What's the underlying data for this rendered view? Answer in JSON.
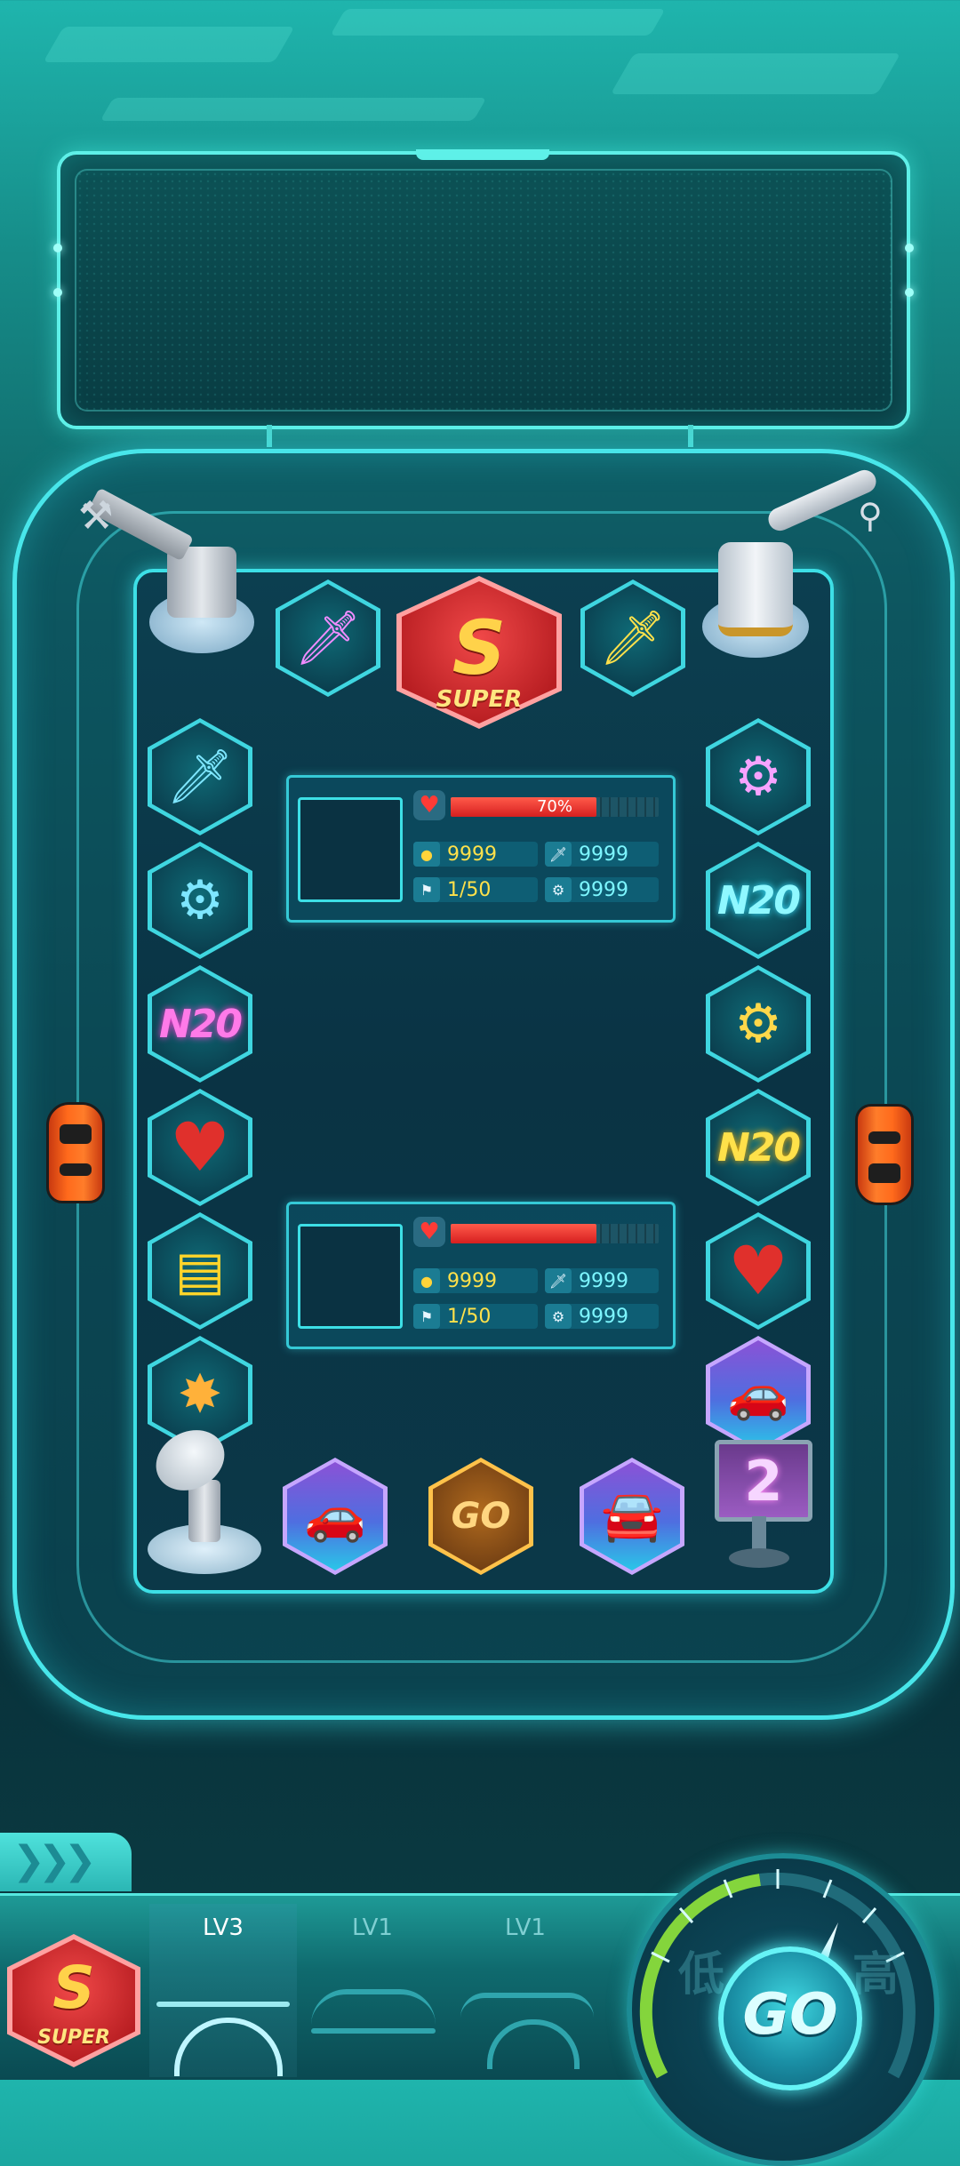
{
  "top": {
    "super_badge": {
      "label": "SUPER"
    },
    "item_tiles": [
      {
        "name": "sword-pink-icon",
        "glyph": "🗡",
        "color": "#f08cff"
      },
      {
        "name": "sword-yellow-icon",
        "glyph": "🗡",
        "color": "#ffe14a"
      }
    ]
  },
  "left_column": [
    {
      "name": "sword-blue-icon",
      "glyph": "🗡",
      "color": "#7ee6ff",
      "type": "glyph"
    },
    {
      "name": "wheel-blue-icon",
      "glyph": "⚙",
      "color": "#7ee6ff",
      "type": "glyph"
    },
    {
      "name": "n2o-pink-icon",
      "text": "N20",
      "color": "#ff7ae8",
      "type": "text"
    },
    {
      "name": "heart-icon",
      "glyph": "♥",
      "color": "#e0302c",
      "type": "glyph"
    },
    {
      "name": "roadblock-icon",
      "glyph": "▤",
      "color": "#ffd52a",
      "type": "glyph"
    },
    {
      "name": "bomb-icon",
      "glyph": "✸",
      "color": "#ffb13a",
      "type": "glyph"
    }
  ],
  "right_column": [
    {
      "name": "wheel-pink-icon",
      "glyph": "⚙",
      "color": "#f7a3ff",
      "type": "glyph"
    },
    {
      "name": "n2o-cyan-icon",
      "text": "N20",
      "color": "#8ff8ff",
      "type": "text"
    },
    {
      "name": "wheel-yellow-icon",
      "glyph": "⚙",
      "color": "#ffd84a",
      "type": "glyph"
    },
    {
      "name": "n2o-yellow-icon",
      "text": "N20",
      "color": "#ffe14a",
      "type": "text"
    },
    {
      "name": "heart-icon",
      "glyph": "♥",
      "color": "#e0302c",
      "type": "glyph"
    },
    {
      "name": "car-upgrade-icon",
      "glyph": "🚗",
      "color": "#ffffff",
      "type": "glyph"
    }
  ],
  "bottom_row": [
    {
      "name": "car-upgrade-icon",
      "glyph": "🚗",
      "color": "#ffffff"
    },
    {
      "name": "go-speedometer-icon",
      "text": "GO",
      "color": "#ffc24a"
    },
    {
      "name": "car-upgrade-icon",
      "glyph": "🚘",
      "color": "#ffffff"
    }
  ],
  "player_panels": [
    {
      "hp_percent": 70,
      "hp_text": "70%",
      "coins": "9999",
      "attack": "9999",
      "laps": "1/50",
      "wheels": "9999"
    },
    {
      "hp_percent": 70,
      "hp_text": "",
      "coins": "9999",
      "attack": "9999",
      "laps": "1/50",
      "wheels": "9999"
    }
  ],
  "counter_screen": {
    "value": "2"
  },
  "bottom_bar": {
    "super_label": "SUPER",
    "levels": [
      {
        "label": "LV3",
        "active": true
      },
      {
        "label": "LV1",
        "active": false
      },
      {
        "label": "LV1",
        "active": false
      }
    ],
    "speedo_left_text": "低",
    "speedo_right_text": "高",
    "go_label": "GO"
  },
  "colors": {
    "accent": "#48e6ea",
    "hp_red": "#e52a24",
    "coin_yellow": "#ffe14a",
    "stat_cyan": "#7df6ff"
  }
}
